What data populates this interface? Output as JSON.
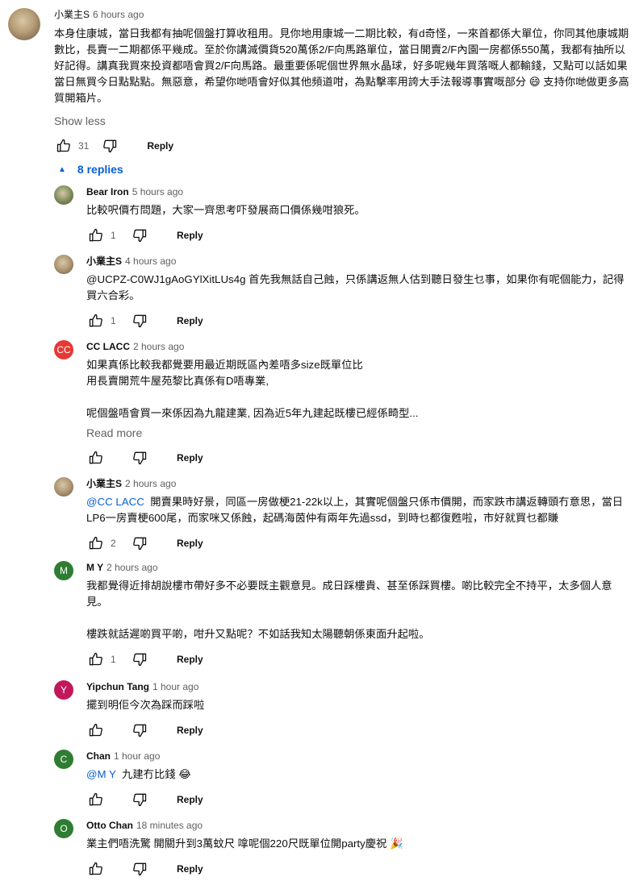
{
  "top_comment": {
    "author": "小業主S",
    "time": "6 hours ago",
    "text": "本身住康城，當日我都有抽呢個盤打算收租用。見你地用康城一二期比較，有d奇怪，一來首都係大單位，你同其他康城期數比，長賣一二期都係平幾成。至於你講減價貨520萬係2/F向馬路單位，當日開賣2/F內園一房都係550萬，我都有抽所以好記得。講真我買來投資都唔會買2/F向馬路。最重要係呢個世界無水晶球，好多呢幾年買落嘅人都輸錢，又點可以話如果當日無買今日點點點。無惡意，希望你哋唔會好似其他頻道咁，為點擊率用誇大手法報導事實嘅部分 😄 支持你哋做更多高質開箱片。",
    "show_less": "Show less",
    "likes": "31",
    "reply_label": "Reply"
  },
  "replies_toggle": "8 replies",
  "replies": [
    {
      "author": "Bear Iron",
      "time": "5 hours ago",
      "avatar": "",
      "avatar_color": "#7a8a5a",
      "mention": "",
      "text": "比較呎價冇問題，大家一齊思考吓發展商口價係幾咁狼死。",
      "likes": "1",
      "read_more": "",
      "reply_label": "Reply"
    },
    {
      "author": "小業主S",
      "time": "4 hours ago",
      "avatar": "",
      "avatar_color": "#a8916d",
      "mention": "",
      "text": "@UCPZ-C0WJ1gAoGYlXitLUs4g 首先我無話自己蝕，只係講返無人估到聽日發生乜事，如果你有呢個能力，記得買六合彩。",
      "likes": "1",
      "read_more": "",
      "reply_label": "Reply"
    },
    {
      "author": "CC LACC",
      "time": "2 hours ago",
      "avatar": "CC",
      "avatar_color": "#e53935",
      "mention": "",
      "text": "如果真係比較我都覺要用最近期既區內差唔多size既單位比\n用長賣開荒牛屋苑黎比真係有D唔專業,\n\n呢個盤唔會買一來係因為九龍建業, 因為近5年九建起既樓已經係畸型...",
      "likes": "",
      "read_more": "Read more",
      "reply_label": "Reply"
    },
    {
      "author": "小業主S",
      "time": "2 hours ago",
      "avatar": "",
      "avatar_color": "#a8916d",
      "mention": "@CC LACC",
      "text": "  開賣果時好景，同區一房做梗21-22k以上，其實呢個盤只係市價開，而家跌市講返轉頭冇意思，當日LP6一房賣梗600尾，而家咪又係蝕，起碼海茵仲有兩年先過ssd，到時乜都復甦啦，市好就買乜都賺",
      "likes": "2",
      "read_more": "",
      "reply_label": "Reply"
    },
    {
      "author": "M Y",
      "time": "2 hours ago",
      "avatar": "M",
      "avatar_color": "#2e7d32",
      "mention": "",
      "text": "我都覺得近排胡說樓市帶好多不必要既主觀意見。成日踩樓貴、甚至係踩買樓。啲比較完全不持平，太多個人意見。\n\n樓跌就話遲啲買平啲，咁升又點呢？不如話我知太陽聽朝係東面升起啦。",
      "likes": "1",
      "read_more": "",
      "reply_label": "Reply"
    },
    {
      "author": "Yipchun Tang",
      "time": "1 hour ago",
      "avatar": "Y",
      "avatar_color": "#c2185b",
      "mention": "",
      "text": "擺到明佢今次為踩而踩啦",
      "likes": "",
      "read_more": "",
      "reply_label": "Reply"
    },
    {
      "author": "Chan",
      "time": "1 hour ago",
      "avatar": "C",
      "avatar_color": "#2e7d32",
      "mention": "@M Y",
      "text": "  九建冇比錢 😂",
      "likes": "",
      "read_more": "",
      "reply_label": "Reply"
    },
    {
      "author": "Otto Chan",
      "time": "18 minutes ago",
      "avatar": "O",
      "avatar_color": "#2e7d32",
      "mention": "",
      "text": "業主們唔洗驚 開關升到3萬蚊尺 嗱呢個220尺既單位開party慶祝 🎉",
      "likes": "",
      "read_more": "",
      "reply_label": "Reply"
    }
  ]
}
